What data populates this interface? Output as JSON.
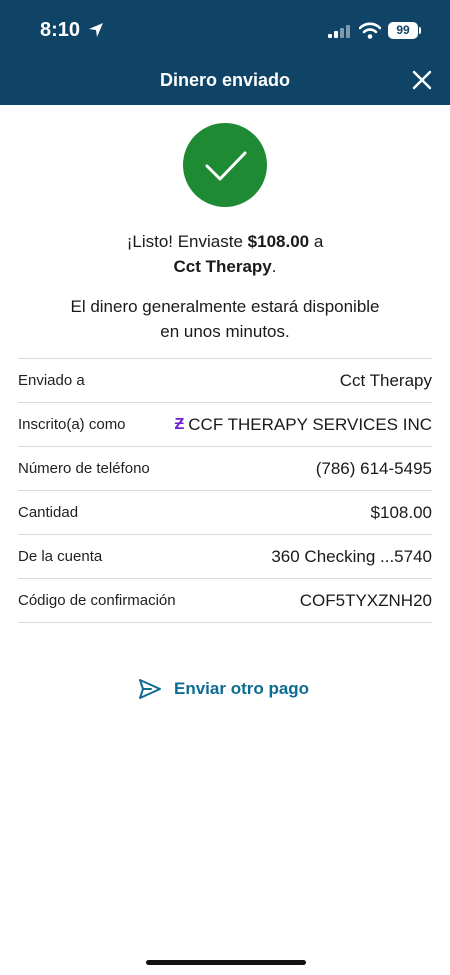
{
  "status_bar": {
    "time": "8:10",
    "battery": "99"
  },
  "header": {
    "title": "Dinero enviado"
  },
  "confirmation": {
    "prefix": "¡Listo! Enviaste ",
    "amount": "$108.00",
    "connector": " a",
    "recipient": "Cct Therapy",
    "suffix": ".",
    "note_line1": "El dinero generalmente estará disponible",
    "note_line2": "en unos minutos."
  },
  "details": [
    {
      "label": "Enviado a",
      "value": "Cct Therapy"
    },
    {
      "label": "Inscrito(a) como",
      "value": "CCF THERAPY SERVICES INC",
      "icon": "zelle-icon"
    },
    {
      "label": "Número de teléfono",
      "value": "(786) 614-5495"
    },
    {
      "label": "Cantidad",
      "value": "$108.00"
    },
    {
      "label": "De la cuenta",
      "value": "360 Checking ...5740"
    },
    {
      "label": "Código de confirmación",
      "value": "COF5TYXZNH20"
    }
  ],
  "actions": {
    "send_again": "Enviar otro pago"
  },
  "colors": {
    "header": "#0f4466",
    "success": "#1e8a34",
    "link": "#0e6b94",
    "zelle": "#6d1ed4"
  }
}
